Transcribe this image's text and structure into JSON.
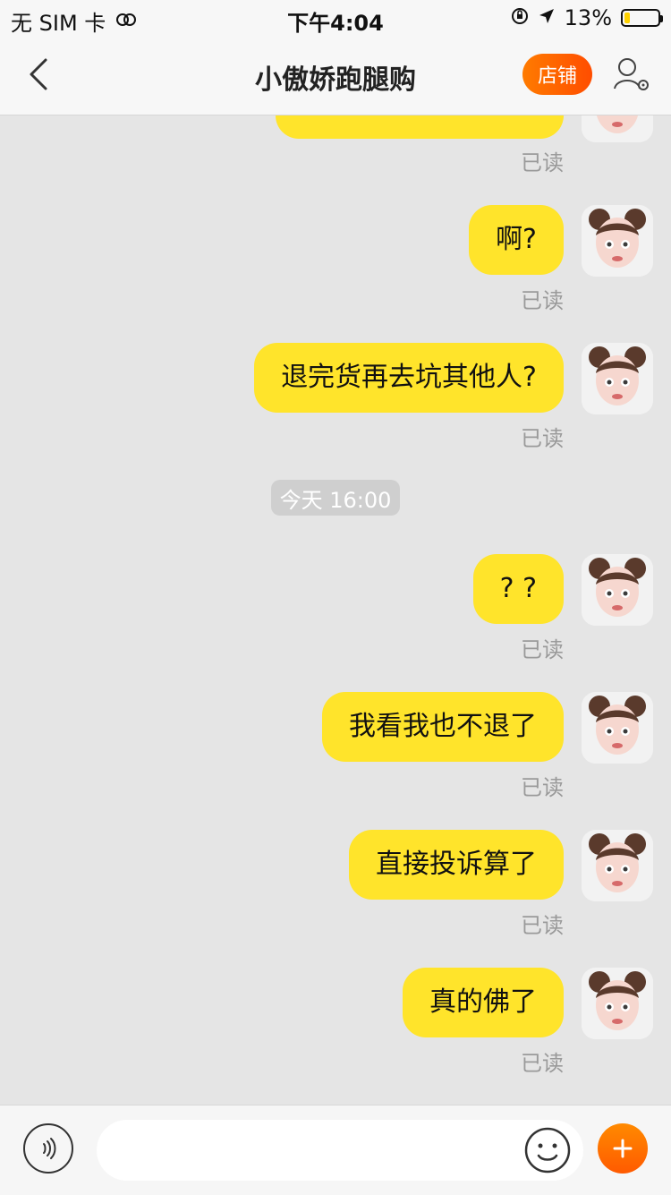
{
  "status_bar": {
    "carrier": "无 SIM 卡",
    "time": "下午4:04",
    "battery_text": "13%",
    "battery_fill": 0.13,
    "icons": [
      "wifi-sync-icon",
      "screen-lock-icon",
      "location-arrow-icon",
      "battery-icon"
    ]
  },
  "nav": {
    "title": "小傲娇跑腿购",
    "store_label": "店铺",
    "back_icon": "back-chevron-icon",
    "profile_icon": "user-settings-icon"
  },
  "chat": {
    "read_label": "已读",
    "timestamp": "今天 16:00",
    "messages": [
      {
        "text": ""
      },
      {
        "text": "啊?"
      },
      {
        "text": "退完货再去坑其他人?"
      },
      {
        "text": "? ?"
      },
      {
        "text": "我看我也不退了"
      },
      {
        "text": "直接投诉算了"
      },
      {
        "text": "真的佛了"
      }
    ]
  },
  "input_bar": {
    "placeholder": "",
    "icons": [
      "voice-icon",
      "emoji-icon",
      "plus-icon"
    ]
  },
  "colors": {
    "bubble": "#ffe42b",
    "accent": "#ff6a00",
    "background": "#e5e5e5"
  }
}
